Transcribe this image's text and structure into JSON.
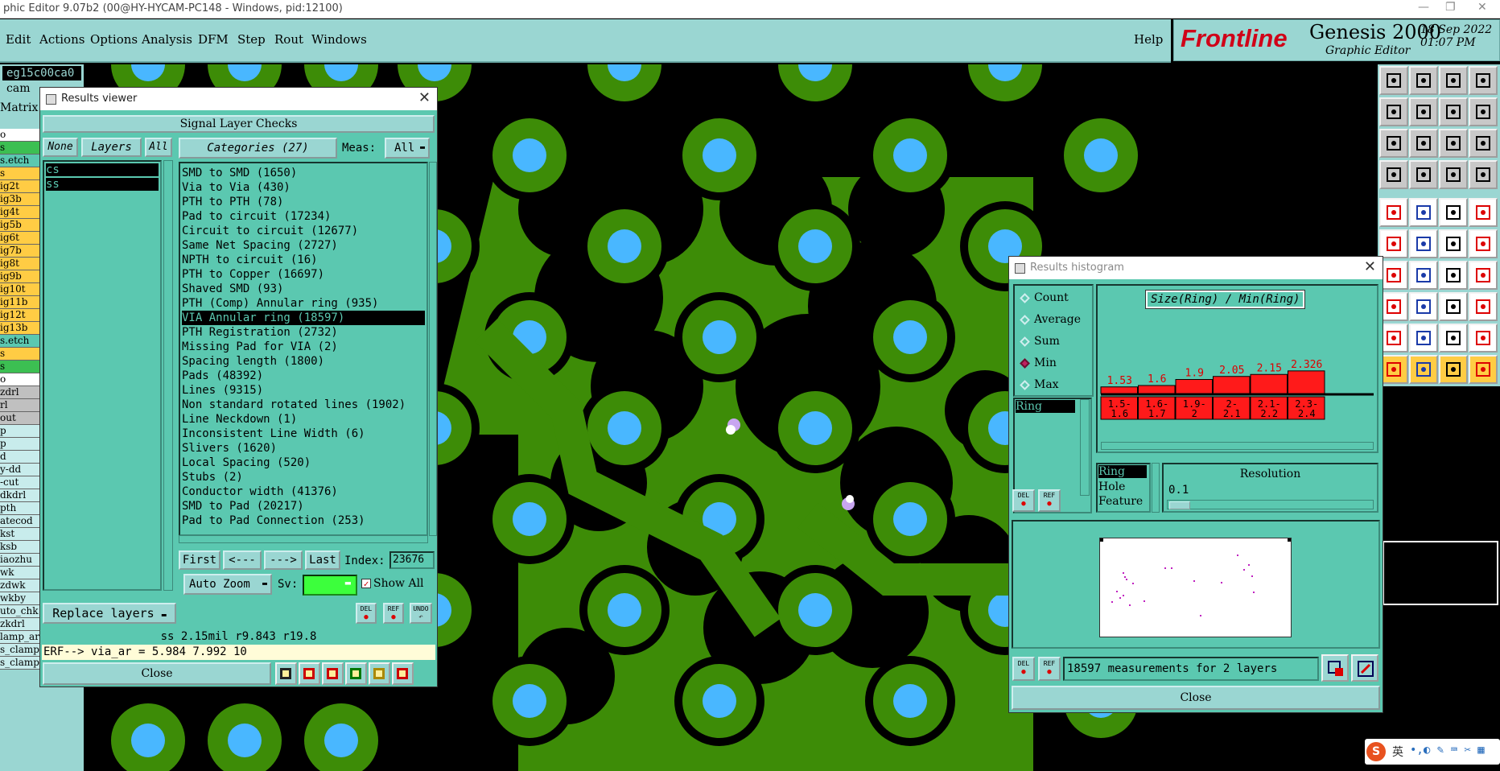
{
  "os_window": {
    "title": "phic Editor 9.07b2 (00@HY-HYCAM-PC148 - Windows, pid:12100)"
  },
  "menu": {
    "items": [
      "Edit",
      "Actions",
      "Options",
      "Analysis",
      "DFM",
      "Step",
      "Rout",
      "Windows"
    ],
    "help": "Help"
  },
  "brand": {
    "logo": "Frontline",
    "product": "Genesis 2000",
    "subtitle": "Graphic Editor",
    "date": "18 Sep 2022",
    "time": "01:07 PM"
  },
  "left_panel": {
    "job": "eg15c00ca0",
    "step": "cam",
    "matrix_label": "Matrix",
    "rows": [
      "o",
      "s",
      "s.etch",
      "s",
      "ig2t",
      "ig3b",
      "ig4t",
      "ig5b",
      "ig6t",
      "ig7b",
      "ig8t",
      "ig9b",
      "ig10t",
      "ig11b",
      "ig12t",
      "ig13b",
      "s.etch",
      "s",
      "s",
      "o",
      "zdrl",
      "rl",
      "out",
      "p",
      "p",
      "d",
      "y-dd",
      "-cut",
      "dkdrl",
      "pth",
      "atecod",
      "kst",
      "ksb",
      "iaozhu",
      "wk",
      "zdwk",
      "wkby",
      "uto_chk",
      "zkdrl",
      "lamp_ar",
      "s_clamp",
      "s_clamp"
    ]
  },
  "results_viewer": {
    "title": "Results viewer",
    "header": "Signal Layer Checks",
    "none_btn": "None",
    "layers_btn": "Layers",
    "all_btn": "All",
    "layers": [
      "cs",
      "ss"
    ],
    "categories_btn": "Categories (27)",
    "meas_label": "Meas:",
    "meas_value": "All",
    "categories": [
      "SMD to SMD (1650)",
      "Via to Via (430)",
      "PTH to PTH (78)",
      "Pad to circuit (17234)",
      "Circuit to circuit (12677)",
      "Same Net Spacing (2727)",
      "NPTH to circuit (16)",
      "PTH to Copper (16697)",
      "Shaved SMD (93)",
      "PTH (Comp) Annular ring (935)",
      "VIA Annular ring (18597)",
      "PTH Registration (2732)",
      "Missing Pad for VIA (2)",
      "Spacing length (1800)",
      "Pads (48392)",
      "Lines (9315)",
      "Non standard rotated lines (1902)",
      "Line Neckdown (1)",
      "Inconsistent Line Width (6)",
      "Slivers (1620)",
      "Local Spacing (520)",
      "Stubs (2)",
      "Conductor width (41376)",
      "SMD to Pad (20217)",
      "Pad to Pad Connection (253)"
    ],
    "selected_category": "VIA Annular ring (18597)",
    "first_btn": "First",
    "prev_btn": "<---",
    "next_btn": "--->",
    "last_btn": "Last",
    "index_label": "Index:",
    "index_value": "23676",
    "auto_zoom": "Auto Zoom",
    "sv_label": "Sv:",
    "show_all": "Show All",
    "replace_layers": "Replace layers",
    "del_btn": "DEL",
    "ref_btn": "REF",
    "undo_btn": "UNDO",
    "status": "ss 2.15mil   r9.843  r19.8",
    "erf": "ERF--> via_ar = 5.984 7.992 10",
    "close_btn": "Close"
  },
  "results_histogram": {
    "title": "Results histogram",
    "modes": [
      "Count",
      "Average",
      "Sum",
      "Min",
      "Max"
    ],
    "selected_mode": "Min",
    "attr_list": [
      "Ring"
    ],
    "chart_title": "Size(Ring) / Min(Ring)",
    "resolution_list": [
      "Ring",
      "Hole",
      "Feature"
    ],
    "resolution_label": "Resolution",
    "resolution_value": "0.1",
    "summary": "18597 measurements for 2 layers",
    "del_btn": "DEL",
    "ref_btn": "REF",
    "close_btn": "Close"
  },
  "chart_data": {
    "type": "bar",
    "title": "Size(Ring) / Min(Ring)",
    "categories": [
      "1.5-1.6",
      "1.6-1.7",
      "1.9-2",
      "2-2.1",
      "2.1-2.2",
      "2.3-2.4"
    ],
    "values": [
      1.53,
      1.6,
      1.9,
      2.05,
      2.15,
      2.326
    ],
    "value_labels": [
      "1.53",
      "1.6",
      "1.9",
      "2.05",
      "2.15",
      "2.326"
    ],
    "bin_labels": [
      [
        "1.5-",
        "1.6"
      ],
      [
        "1.6-",
        "1.7"
      ],
      [
        "1.9-",
        "2"
      ],
      [
        "2-",
        "2.1"
      ],
      [
        "2.1-",
        "2.2"
      ],
      [
        "2.3-",
        "2.4"
      ]
    ],
    "bar_color": "#ff1a1a"
  },
  "colors": {
    "copper": "#3d8c07",
    "drill": "#49b7ff",
    "panel": "#9ad6d2",
    "window": "#5bc8b0",
    "brand_red": "#d00018"
  }
}
